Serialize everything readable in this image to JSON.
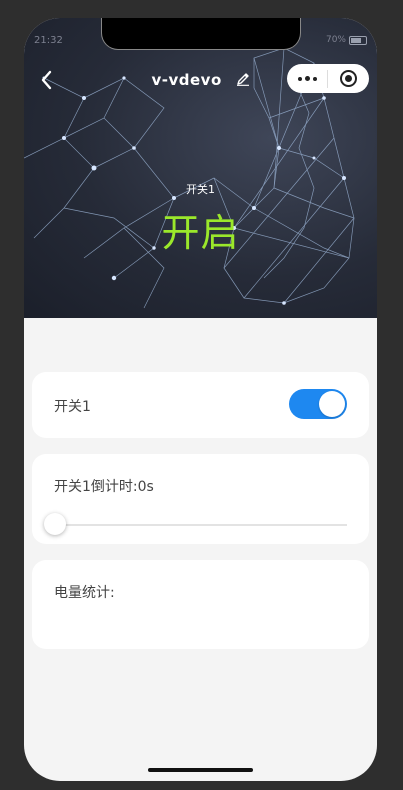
{
  "status_bar": {
    "time": "21:32",
    "battery": "70%"
  },
  "nav": {
    "back_icon": "chevron-left-icon",
    "title": "v-vdevo",
    "edit_icon": "pencil-icon",
    "capsule_more_icon": "more-dots-icon",
    "capsule_close_icon": "target-close-icon"
  },
  "hero": {
    "switch_label": "开关1",
    "state": "开启",
    "state_color": "#9be82b"
  },
  "switch_card": {
    "label": "开关1",
    "toggle_on": true,
    "accent": "#1e88f0"
  },
  "countdown_card": {
    "label": "开关1倒计时:0s",
    "slider_value": 0
  },
  "power_card": {
    "label": "电量统计:"
  }
}
